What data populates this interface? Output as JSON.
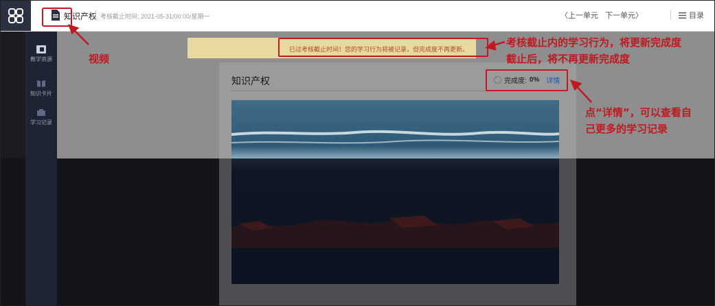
{
  "topbar": {
    "title": "知识产权",
    "deadline": "考核截止时间: 2021-05-31/00:00/星期一",
    "prev_unit": "〈上一单元",
    "next_unit": "下一单元〉",
    "menu_label": "目录"
  },
  "sidebar": {
    "items": [
      {
        "label": "教学资源",
        "icon": "book-icon"
      },
      {
        "label": "知识卡片",
        "icon": "card-icon"
      },
      {
        "label": "学习记录",
        "icon": "record-icon"
      }
    ]
  },
  "notice": {
    "text": "已过考核截止时间！您的学习行为将被记录，但完成度不再更新。"
  },
  "card": {
    "title": "知识产权",
    "progress_label": "完成度:",
    "progress_value": "0%",
    "detail_link": "详情"
  },
  "annotations": {
    "video": "视频",
    "deadline_note_line1": "考核截止内的学习行为，将更新完成度",
    "deadline_note_line2": "截止后，将不再更新完成度",
    "detail_note_line1": "点“详情”，可以查看自",
    "detail_note_line2": "己更多的学习记录"
  },
  "colors": {
    "annotation_red": "#c0191f",
    "link_blue": "#1a55c6",
    "sidebar_bg": "#1e2433"
  }
}
